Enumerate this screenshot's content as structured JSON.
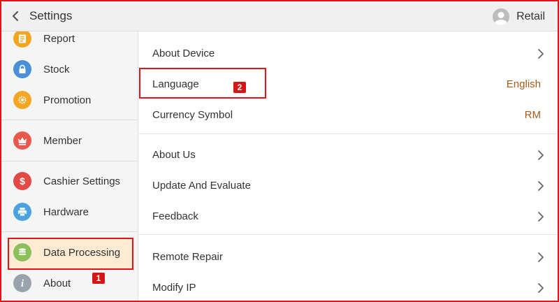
{
  "header": {
    "title": "Settings",
    "user_label": "Retail",
    "back_icon": "chevron-left-icon",
    "avatar_icon": "user-avatar-icon"
  },
  "sidebar": {
    "items": [
      {
        "label": "Report",
        "icon": "report-icon",
        "color": "#f4a623"
      },
      {
        "label": "Stock",
        "icon": "lock-icon",
        "color": "#4a90d9"
      },
      {
        "label": "Promotion",
        "icon": "gear-icon",
        "color": "#f5a623"
      },
      {
        "label": "Member",
        "icon": "crown-icon",
        "color": "#e9584c"
      },
      {
        "label": "Cashier Settings",
        "icon": "dollar-icon",
        "color": "#e24b45"
      },
      {
        "label": "Hardware",
        "icon": "printer-icon",
        "color": "#4aa3df"
      },
      {
        "label": "Data Processing",
        "icon": "database-icon",
        "color": "#8bbf5a"
      },
      {
        "label": "About",
        "icon": "info-icon",
        "color": "#9aa3ad",
        "selected": true
      }
    ]
  },
  "content": {
    "rows": [
      {
        "label": "About Device",
        "value": "",
        "chevron": true
      },
      {
        "label": "Language",
        "value": "English",
        "chevron": false
      },
      {
        "label": "Currency Symbol",
        "value": "RM",
        "chevron": false
      },
      {
        "label": "About Us",
        "value": "",
        "chevron": true
      },
      {
        "label": "Update And Evaluate",
        "value": "",
        "chevron": true
      },
      {
        "label": "Feedback",
        "value": "",
        "chevron": true
      },
      {
        "label": "Remote Repair",
        "value": "",
        "chevron": true
      },
      {
        "label": "Modify IP",
        "value": "",
        "chevron": true
      }
    ]
  },
  "annotations": {
    "badge_1": "1",
    "badge_2": "2"
  },
  "colors": {
    "accent": "#e3131b",
    "value_text": "#a65a18",
    "selected_bg": "#fdebd3"
  }
}
